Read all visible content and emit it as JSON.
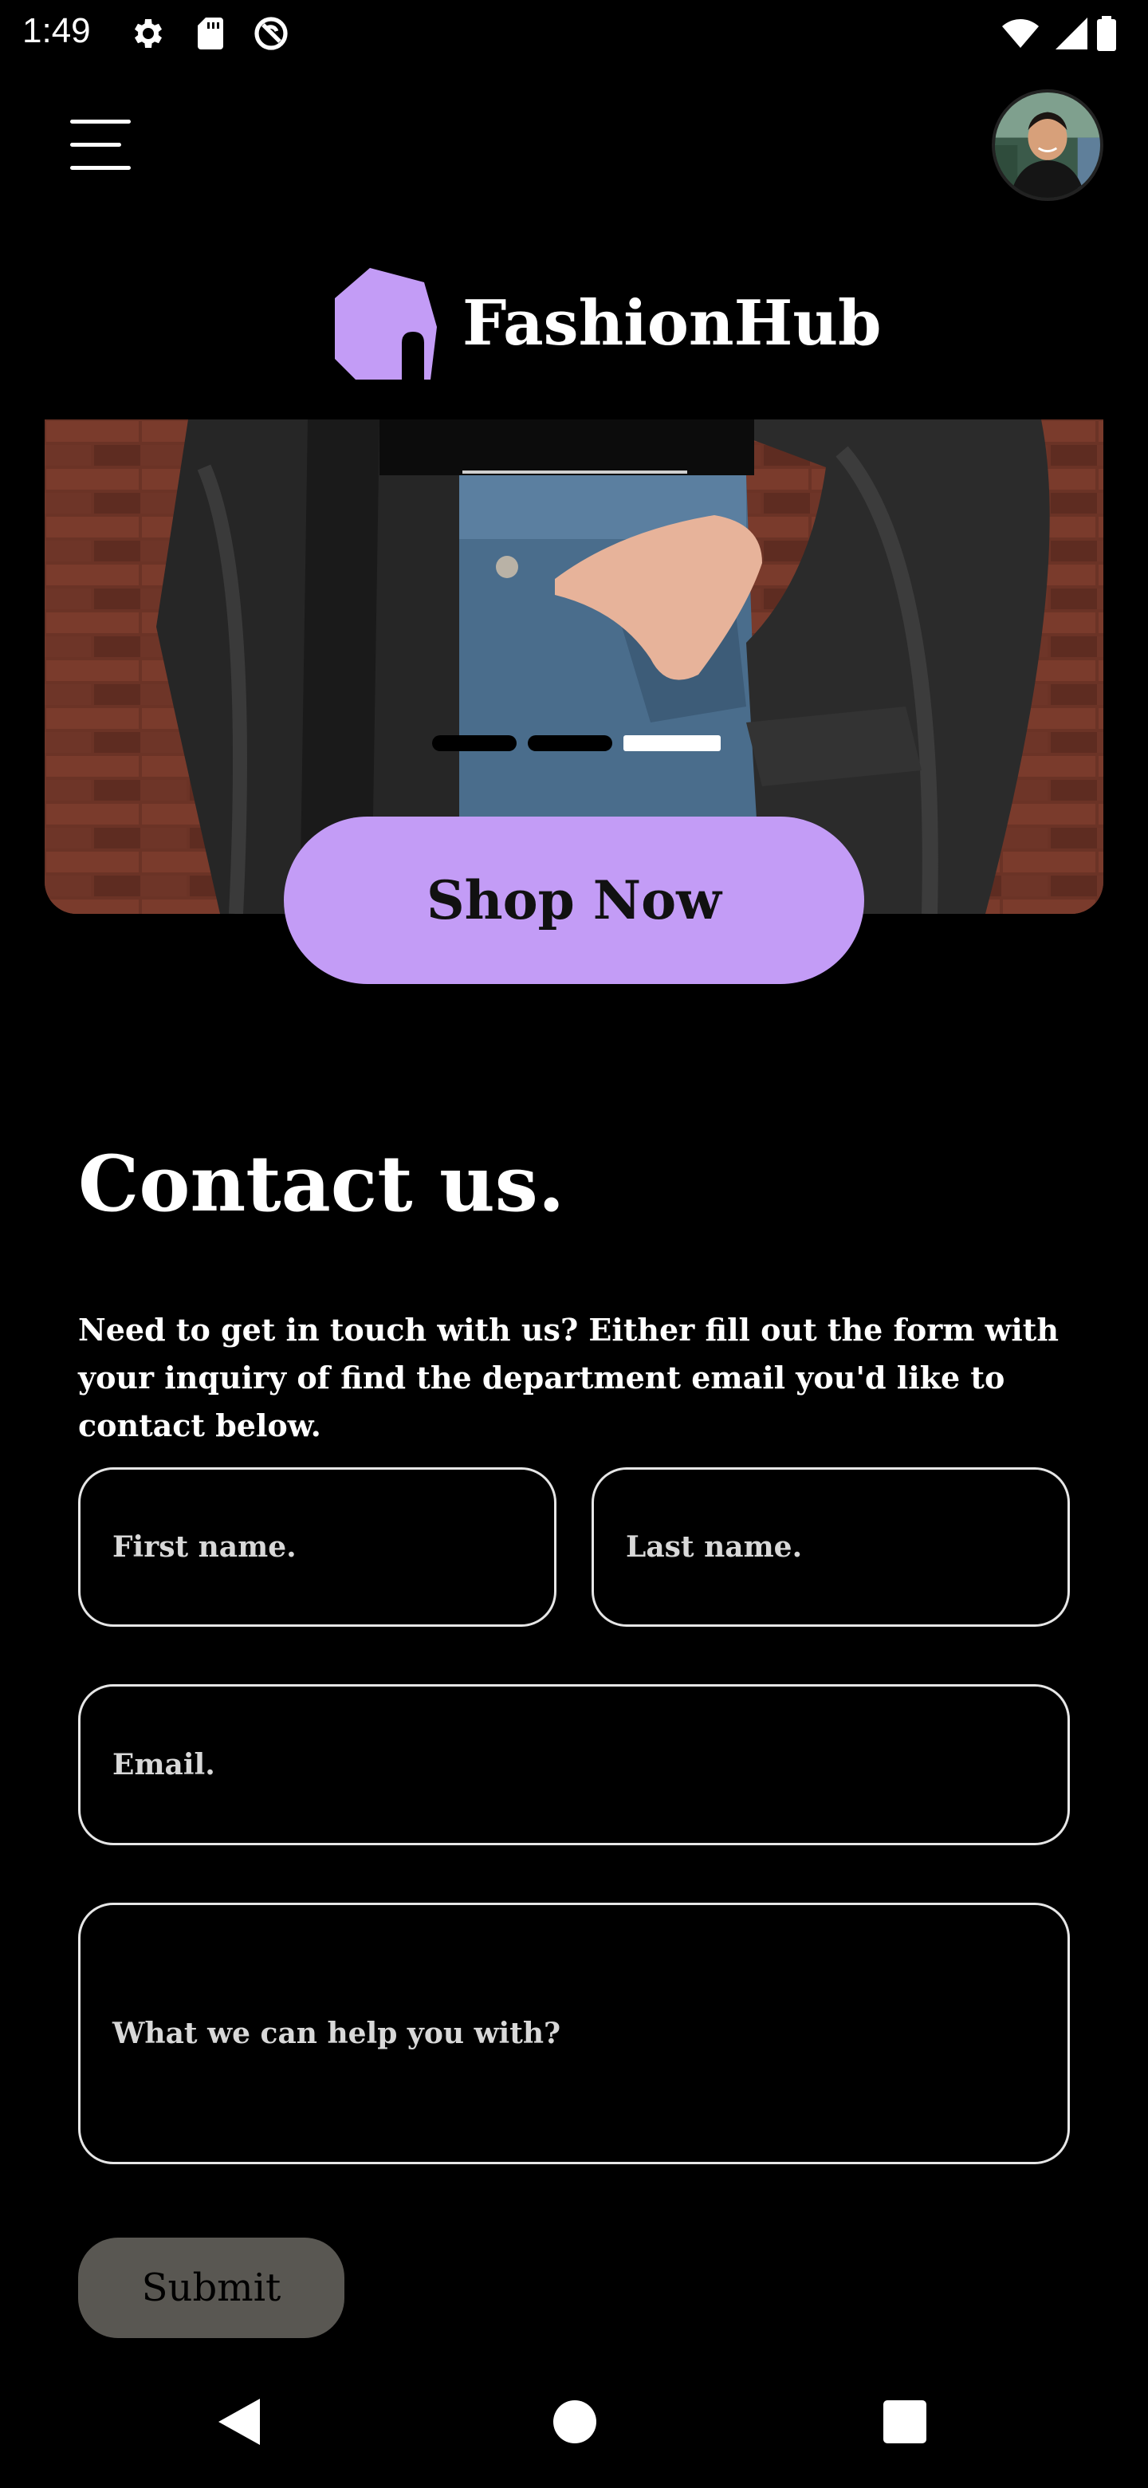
{
  "status_bar": {
    "time": "1:49",
    "left_icons": [
      "settings-icon",
      "sd-card-icon",
      "do-not-disturb-icon"
    ],
    "right_icons": [
      "wifi-icon",
      "cellular-signal-icon",
      "battery-icon"
    ]
  },
  "header": {
    "menu_icon": "hamburger-menu-icon",
    "avatar": "user-avatar"
  },
  "brand": {
    "name": "FashionHub",
    "icon": "house-logo-icon",
    "accent_color": "#c39cf6"
  },
  "hero": {
    "image": "model-in-leather-jacket-and-jeans",
    "carousel_count": 3,
    "carousel_active_index": 2,
    "cta_label": "Shop Now"
  },
  "contact": {
    "title": "Contact us.",
    "description": "Need to get in touch with us? Either fill out the form with your inquiry of find the department email you'd like to contact below.",
    "first_name_placeholder": "First name.",
    "last_name_placeholder": "Last name.",
    "email_placeholder": "Email.",
    "message_placeholder": "What we can help you with?",
    "submit_label": "Submit"
  },
  "nav_bar": {
    "icons": [
      "back-icon",
      "home-icon",
      "recents-icon"
    ]
  }
}
